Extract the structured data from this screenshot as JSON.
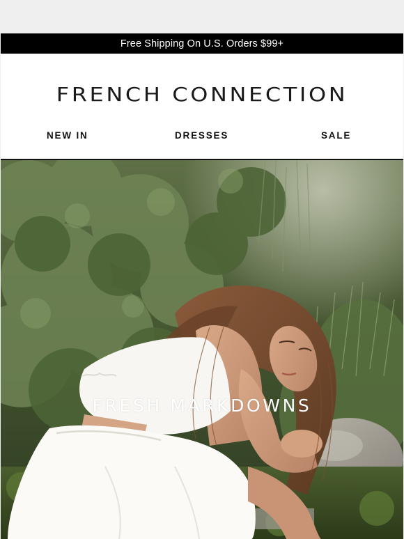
{
  "promo": {
    "text": "Free Shipping On U.S. Orders $99+"
  },
  "brand": {
    "name": "FRENCH CONNECTION"
  },
  "nav": {
    "items": [
      {
        "label": "NEW IN"
      },
      {
        "label": "DRESSES"
      },
      {
        "label": "SALE"
      }
    ]
  },
  "hero": {
    "headline": "FRESH MARKDOWNS",
    "image_icon": "photo-image"
  },
  "colors": {
    "promo_background": "#000000",
    "promo_text": "#ffffff",
    "brand_text": "#1a1a1a",
    "page_background": "#efefef"
  }
}
